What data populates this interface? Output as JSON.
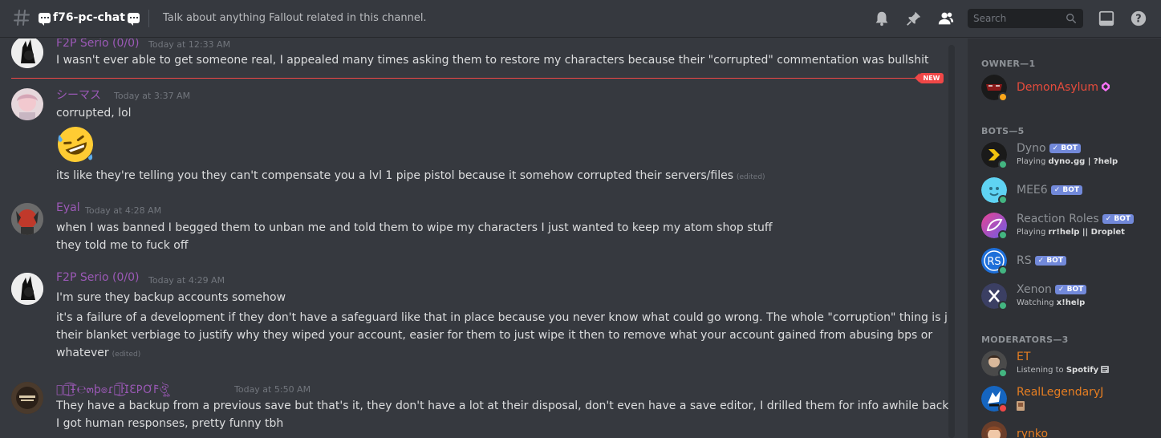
{
  "header": {
    "channel_name": "f76-pc-chat",
    "topic": "Talk about anything Fallout related in this channel.",
    "search_placeholder": "Search",
    "icons": [
      "hash-icon",
      "bell-icon",
      "pin-icon",
      "members-icon",
      "search-icon",
      "inbox-icon",
      "help-icon"
    ]
  },
  "messages": [
    {
      "author": "F2P Serio (0/0)",
      "author_color": "#9b59b6",
      "timestamp": "Today at 12:33 AM",
      "lines": [
        "I wasn't ever able to get someone real, I appealed many times asking them to restore my characters because their \"corrupted\" commentation was bullshit"
      ]
    },
    {
      "author": "シーマス",
      "author_color": "#9b59b6",
      "timestamp": "Today at 3:37 AM",
      "lines": [
        "corrupted, lol",
        "its like they're telling you they can't compensate you a lvl 1 pipe pistol because it somehow corrupted their servers/files"
      ],
      "emoji": "rofl-emoji",
      "edited": "(edited)"
    },
    {
      "author": "Eyal",
      "author_color": "#9b59b6",
      "timestamp": "Today at 4:28 AM",
      "lines": [
        "when I was banned I begged them to unban me and told them to wipe my characters I just wanted to keep my atom shop stuff",
        "they told me to fuck off"
      ]
    },
    {
      "author": "F2P Serio (0/0)",
      "author_color": "#9b59b6",
      "timestamp": "Today at 4:29 AM",
      "lines": [
        "I'm sure they backup accounts somehow",
        "it's a failure of a development if they don't have a safeguard like that in place because you never know what could go wrong.  The whole \"corruption\" thing is just",
        "their blanket verbiage to justify why they wiped your account, easier for them to just wipe it then to remove what your account gained from abusing bps or",
        "whatever"
      ],
      "edited": "(edited)"
    },
    {
      "author": "ঔৣ͜͡Ŧ℮๓þ๏ɾล͜͡ŀ𐌆Ɛ𐌓Ơ𐌅ঔৣ",
      "author_color": "#9b59b6",
      "timestamp": "Today at 5:50 AM",
      "lines": [
        "They have a backup from a previous save but that's it, they don't have a lot at their disposal, don't even have a save editor, I drilled them for info awhile back when",
        "I got human responses, pretty funny tbh"
      ]
    }
  ],
  "new_badge": "NEW",
  "members": {
    "owner_label": "OWNER—1",
    "owner": [
      {
        "name": "DemonAsylum",
        "color": "#e74c3c",
        "status": "idle",
        "badge_icon": "nitro-boost-icon"
      }
    ],
    "bots_label": "BOTS—5",
    "bots": [
      {
        "name": "Dyno",
        "color": "#8e9297",
        "bot_label": "BOT",
        "activity_prefix": "Playing ",
        "activity": "dyno.gg | ?help",
        "status": "online"
      },
      {
        "name": "MEE6",
        "color": "#8e9297",
        "bot_label": "BOT",
        "activity_prefix": "",
        "activity": "",
        "status": "online"
      },
      {
        "name": "Reaction Roles",
        "color": "#8e9297",
        "bot_label": "BOT",
        "activity_prefix": "Playing ",
        "activity": "rr!help || Droplet",
        "status": "online"
      },
      {
        "name": "RS",
        "color": "#8e9297",
        "bot_label": "BOT",
        "activity_prefix": "",
        "activity": "",
        "status": "online"
      },
      {
        "name": "Xenon",
        "color": "#8e9297",
        "bot_label": "BOT",
        "activity_prefix": "Watching ",
        "activity": "x!help",
        "status": "online"
      }
    ],
    "mods_label": "MODERATORS—3",
    "mods": [
      {
        "name": "ET",
        "color": "#e67e22",
        "activity_prefix": "Listening to ",
        "activity": "Spotify",
        "status": "online"
      },
      {
        "name": "RealLegendaryJ",
        "color": "#e67e22",
        "activity_prefix": "",
        "activity": "",
        "status": "dnd"
      },
      {
        "name": "rynko",
        "color": "#e67e22",
        "activity_prefix": "",
        "activity": "",
        "status": "online"
      }
    ]
  },
  "colors": {
    "bg": "#36393f",
    "sidebar": "#2f3136",
    "new_line": "#f04747",
    "online": "#43b581",
    "idle": "#faa61a",
    "dnd": "#f04747",
    "bot_badge": "#7289da"
  }
}
